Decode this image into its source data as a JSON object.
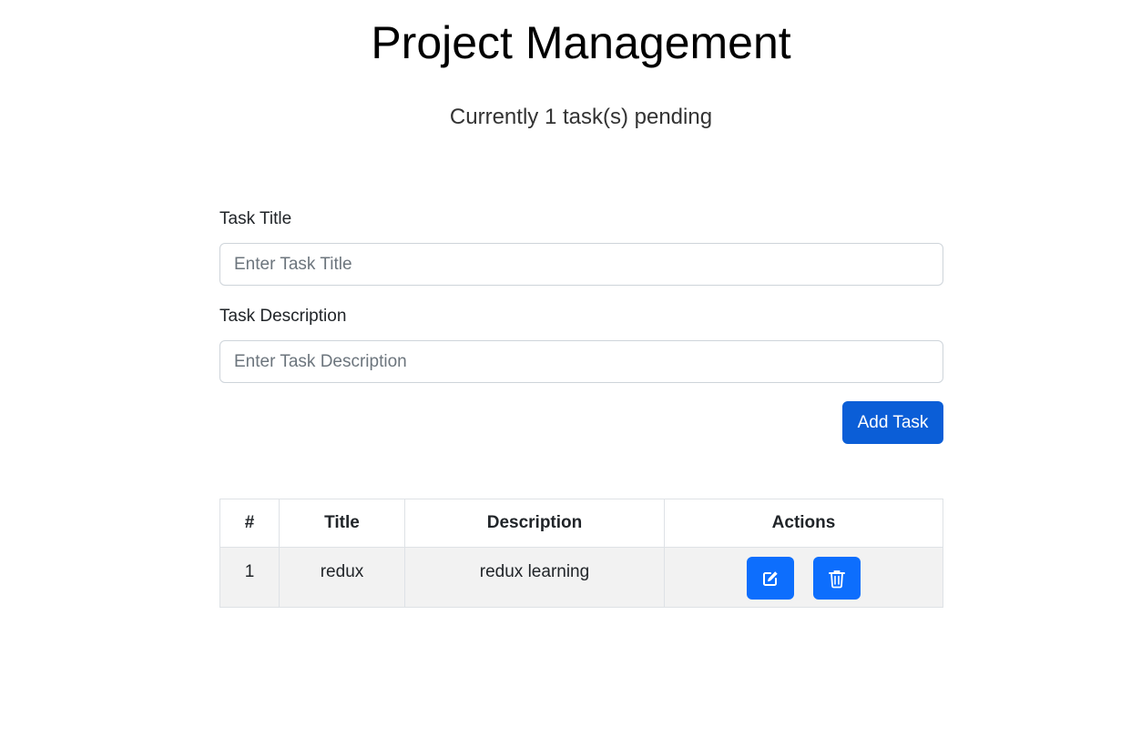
{
  "header": {
    "title": "Project Management",
    "subtitle": "Currently 1 task(s) pending"
  },
  "form": {
    "title_label": "Task Title",
    "title_placeholder": "Enter Task Title",
    "title_value": "",
    "description_label": "Task Description",
    "description_placeholder": "Enter Task Description",
    "description_value": "",
    "add_button_label": "Add Task"
  },
  "table": {
    "headers": [
      "#",
      "Title",
      "Description",
      "Actions"
    ],
    "rows": [
      {
        "index": "1",
        "title": "redux",
        "description": "redux learning",
        "actions": {
          "edit_icon": "edit-icon",
          "delete_icon": "trash-icon"
        }
      }
    ]
  },
  "colors": {
    "primary": "#0d6efd",
    "add_button": "#0b5ed7",
    "row_background": "#f2f2f2",
    "border": "#dee2e6"
  }
}
